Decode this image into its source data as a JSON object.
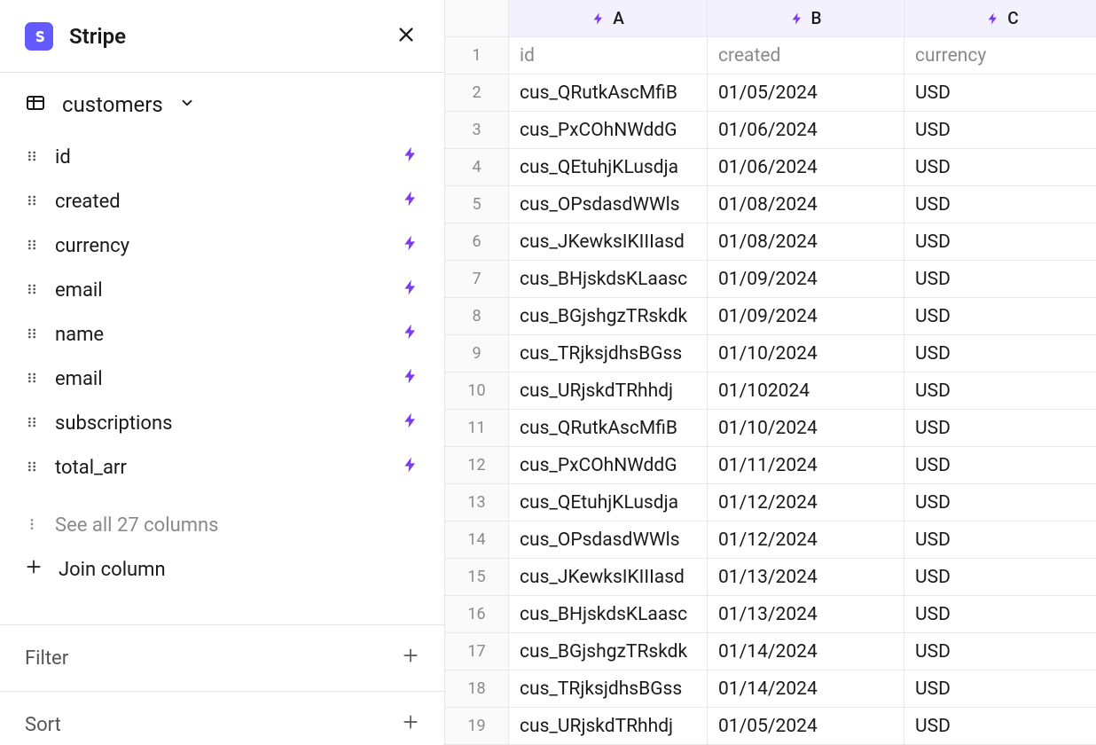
{
  "brand": {
    "name": "Stripe"
  },
  "table_picker": {
    "name": "customers"
  },
  "fields": [
    {
      "name": "id"
    },
    {
      "name": "created"
    },
    {
      "name": "currency"
    },
    {
      "name": "email"
    },
    {
      "name": "name"
    },
    {
      "name": "email"
    },
    {
      "name": "subscriptions"
    },
    {
      "name": "total_arr"
    }
  ],
  "see_all": "See all 27 columns",
  "join_column": "Join column",
  "sections": {
    "filter": "Filter",
    "sort": "Sort"
  },
  "grid": {
    "col_labels": [
      "A",
      "B",
      "C"
    ],
    "field_headers": [
      "id",
      "created",
      "currency"
    ],
    "rows": [
      {
        "n": 2,
        "a": "cus_QRutkAscMfiB",
        "b": "01/05/2024",
        "c": "USD"
      },
      {
        "n": 3,
        "a": "cus_PxCOhNWddG",
        "b": "01/06/2024",
        "c": "USD"
      },
      {
        "n": 4,
        "a": "cus_QEtuhjKLusdja",
        "b": "01/06/2024",
        "c": "USD"
      },
      {
        "n": 5,
        "a": "cus_OPsdasdWWls",
        "b": "01/08/2024",
        "c": "USD"
      },
      {
        "n": 6,
        "a": "cus_JKewksIKIIIasd",
        "b": "01/08/2024",
        "c": "USD"
      },
      {
        "n": 7,
        "a": "cus_BHjskdsKLaasc",
        "b": "01/09/2024",
        "c": "USD"
      },
      {
        "n": 8,
        "a": "cus_BGjshgzTRskdk",
        "b": "01/09/2024",
        "c": "USD"
      },
      {
        "n": 9,
        "a": "cus_TRjksjdhsBGss",
        "b": "01/10/2024",
        "c": "USD"
      },
      {
        "n": 10,
        "a": "cus_URjskdTRhhdj",
        "b": "01/102024",
        "c": "USD"
      },
      {
        "n": 11,
        "a": "cus_QRutkAscMfiB",
        "b": "01/10/2024",
        "c": "USD"
      },
      {
        "n": 12,
        "a": "cus_PxCOhNWddG",
        "b": "01/11/2024",
        "c": "USD"
      },
      {
        "n": 13,
        "a": "cus_QEtuhjKLusdja",
        "b": "01/12/2024",
        "c": "USD"
      },
      {
        "n": 14,
        "a": "cus_OPsdasdWWls",
        "b": "01/12/2024",
        "c": "USD"
      },
      {
        "n": 15,
        "a": "cus_JKewksIKIIIasd",
        "b": "01/13/2024",
        "c": "USD"
      },
      {
        "n": 16,
        "a": "cus_BHjskdsKLaasc",
        "b": "01/13/2024",
        "c": "USD"
      },
      {
        "n": 17,
        "a": "cus_BGjshgzTRskdk",
        "b": "01/14/2024",
        "c": "USD"
      },
      {
        "n": 18,
        "a": "cus_TRjksjdhsBGss",
        "b": "01/14/2024",
        "c": "USD"
      },
      {
        "n": 19,
        "a": "cus_URjskdTRhhdj",
        "b": "01/05/2024",
        "c": "USD"
      }
    ]
  }
}
